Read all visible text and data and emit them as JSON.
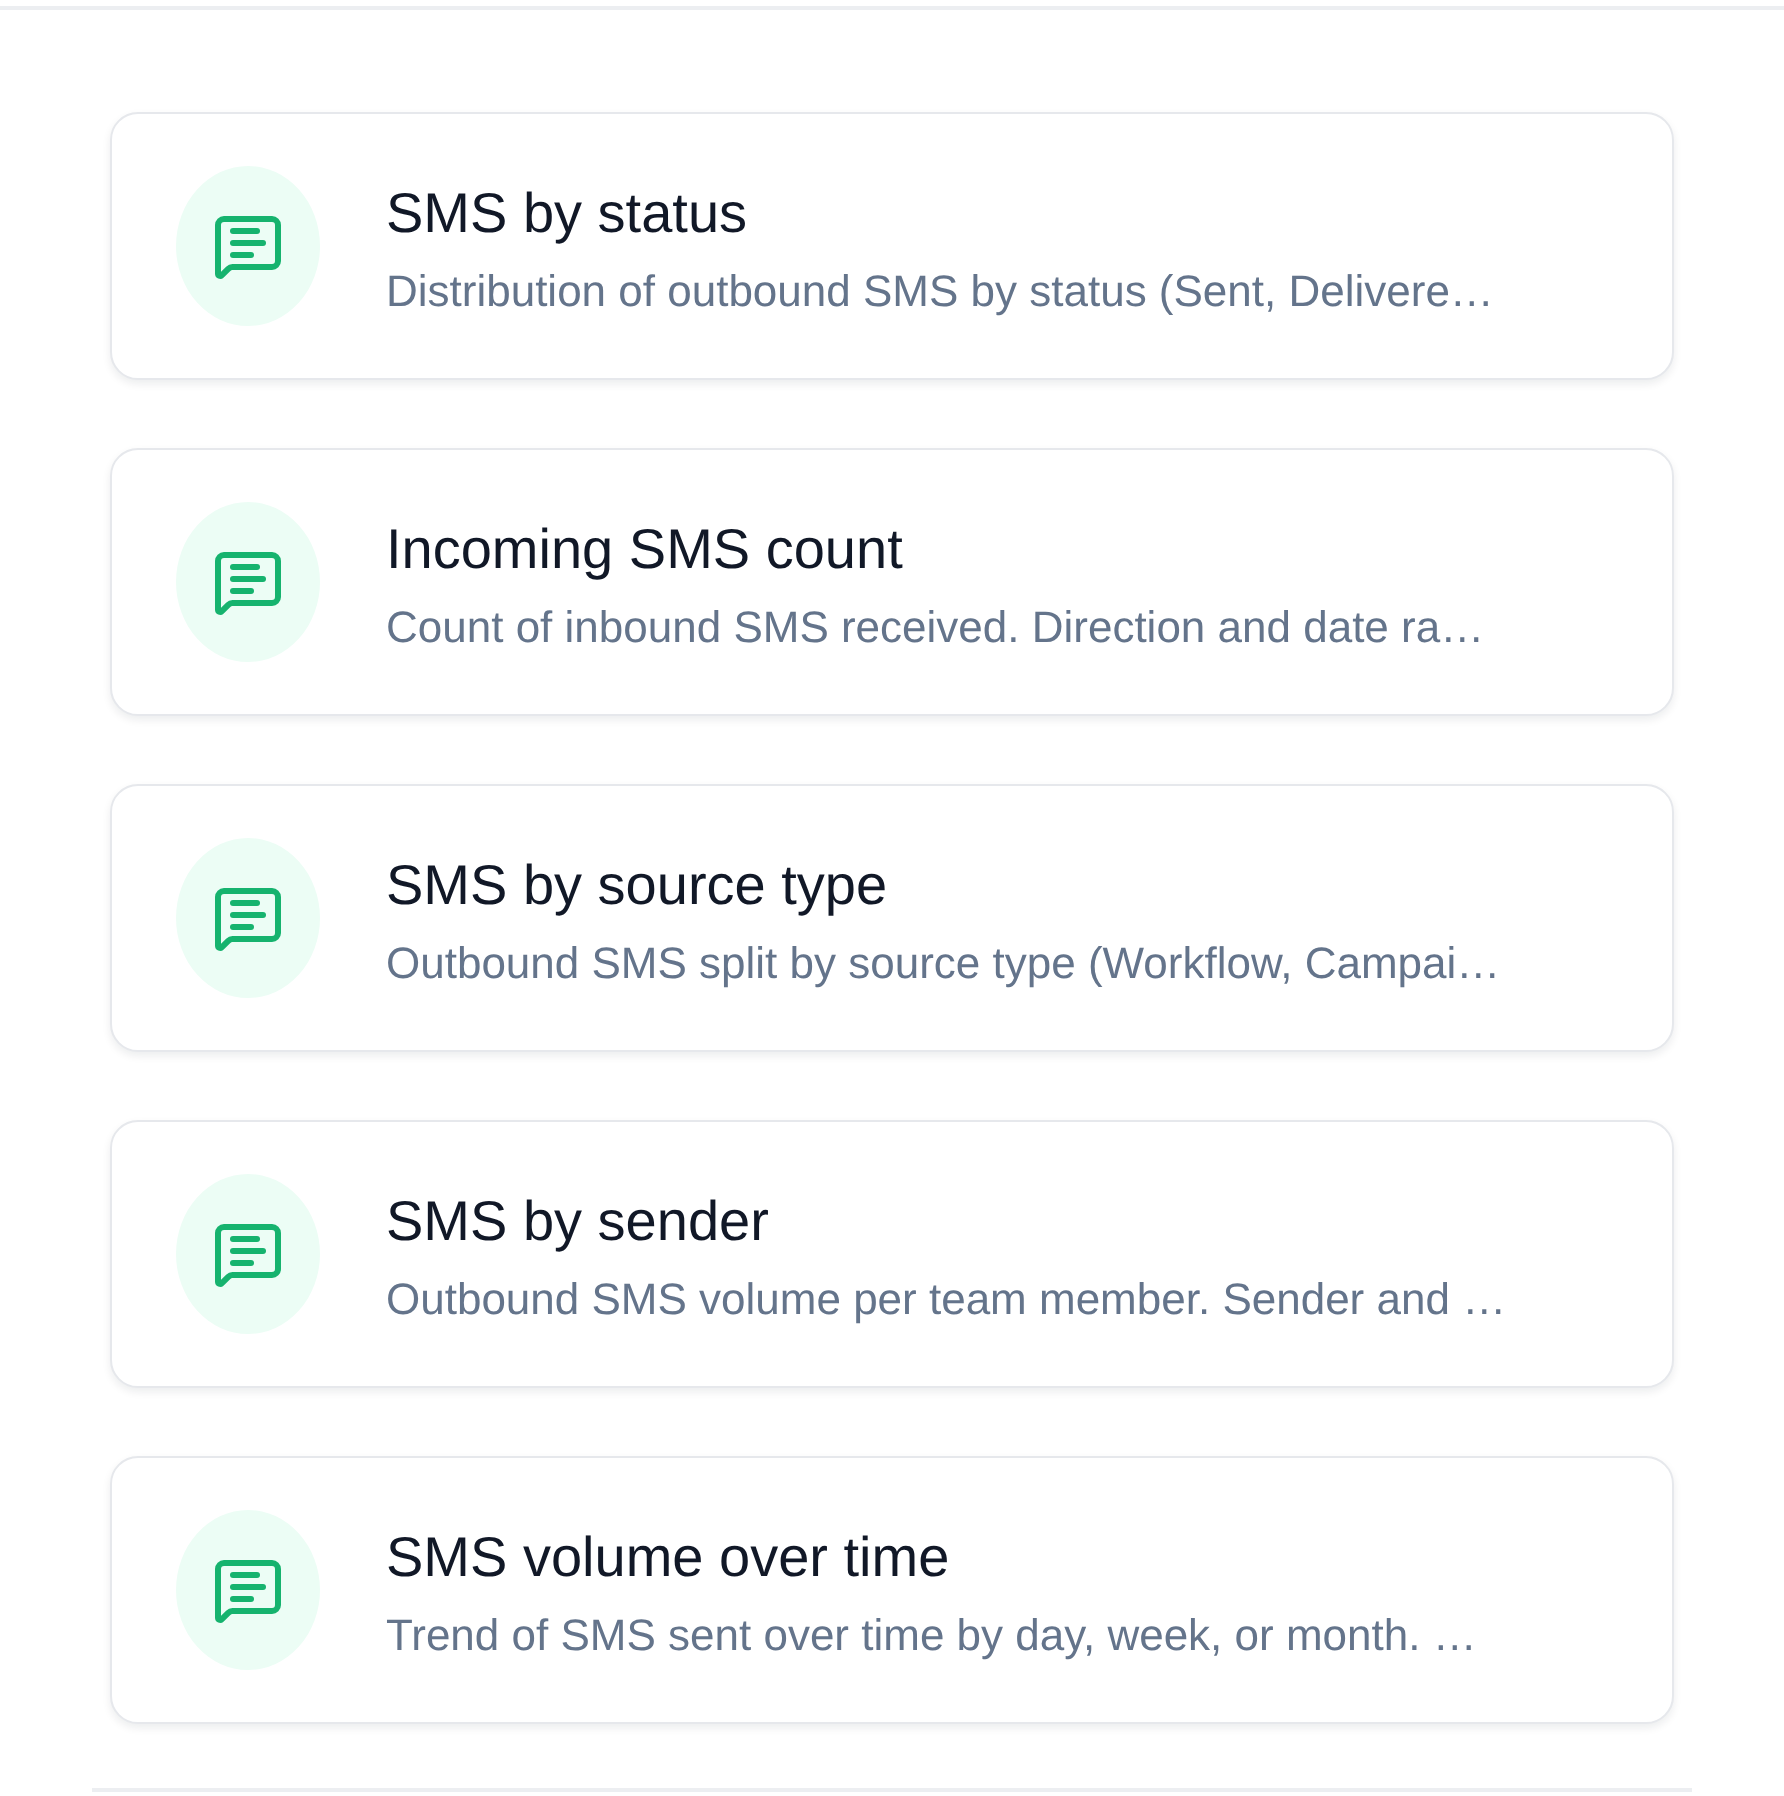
{
  "reports": [
    {
      "title": "SMS by status",
      "description": "Distribution of outbound SMS by status (Sent, Delivere…"
    },
    {
      "title": "Incoming SMS count",
      "description": "Count of inbound SMS received. Direction and date ra…"
    },
    {
      "title": "SMS by source type",
      "description": "Outbound SMS split by source type (Workflow, Campai…"
    },
    {
      "title": "SMS by sender",
      "description": "Outbound SMS volume per team member. Sender and …"
    },
    {
      "title": "SMS volume over time",
      "description": "Trend of SMS sent over time by day, week, or month. …"
    }
  ]
}
